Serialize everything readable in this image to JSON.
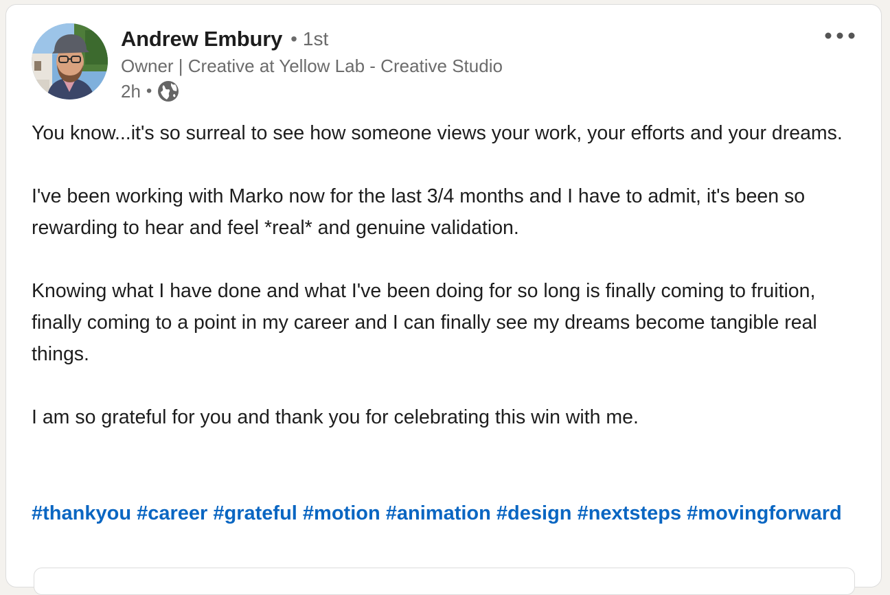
{
  "post": {
    "author": {
      "name": "Andrew Embury",
      "degree": "1st",
      "headline": "Owner | Creative at Yellow Lab - Creative Studio",
      "time": "2h",
      "visibility_icon": "globe-icon",
      "avatar_icon": "profile-photo"
    },
    "more_icon": "more-options-icon",
    "paragraphs": [
      "You know...it's so surreal to see how someone views your work, your efforts and your dreams.",
      "I've been working with Marko now for the last 3/4 months and I have to admit, it's been so rewarding to hear and feel *real* and genuine validation.",
      "Knowing what I have done and what I've been doing for so long is finally coming to fruition, finally coming to a point in my career and I can finally see my dreams become tangible real things.",
      "I am so grateful for you and thank you for celebrating this win with me."
    ],
    "hashtags": [
      "#thankyou",
      "#career",
      "#grateful",
      "#motion",
      "#animation",
      "#design",
      "#nextsteps",
      "#movingforward"
    ]
  },
  "colors": {
    "link": "#0a66c2",
    "text": "#1d1d1d",
    "muted": "#6b6b6b",
    "card_border": "#dcdcdc"
  }
}
